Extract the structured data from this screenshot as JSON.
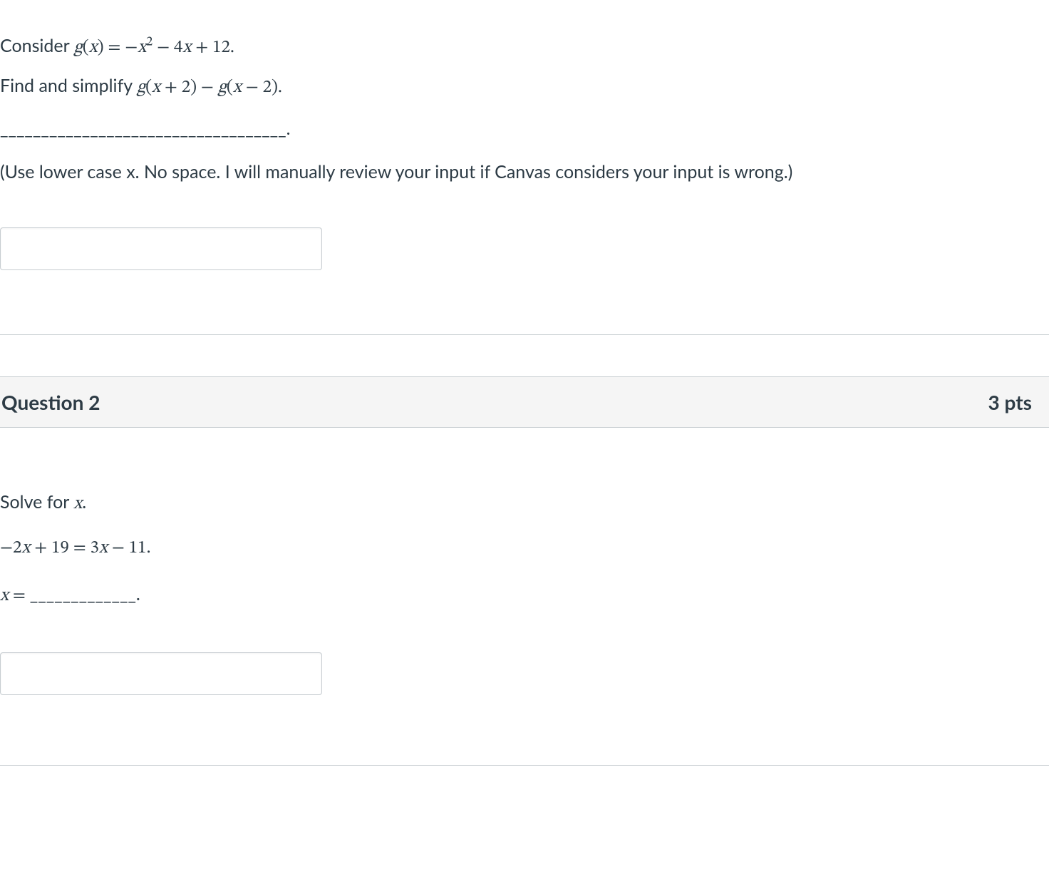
{
  "q1": {
    "consider_prefix": "Consider ",
    "g_of_x": "g(x) = −x",
    "g_of_x_exp": "2",
    "g_of_x_tail": " − 4x + 12.",
    "find_prefix": "Find and simplify  ",
    "expr": "g(x + 2) − g(x − 2).",
    "blank": "___________________________________.",
    "note": "(Use lower case x. No space. I will manually review your input if Canvas considers your input is wrong.)"
  },
  "q2": {
    "header_title": "Question 2",
    "header_points": "3 pts",
    "solve_prefix": "Solve for ",
    "solve_var": "x",
    "solve_suffix": ".",
    "equation": "−2x + 19 = 3x − 11.",
    "answer_prefix": "x = ",
    "answer_blank": "_____________."
  }
}
